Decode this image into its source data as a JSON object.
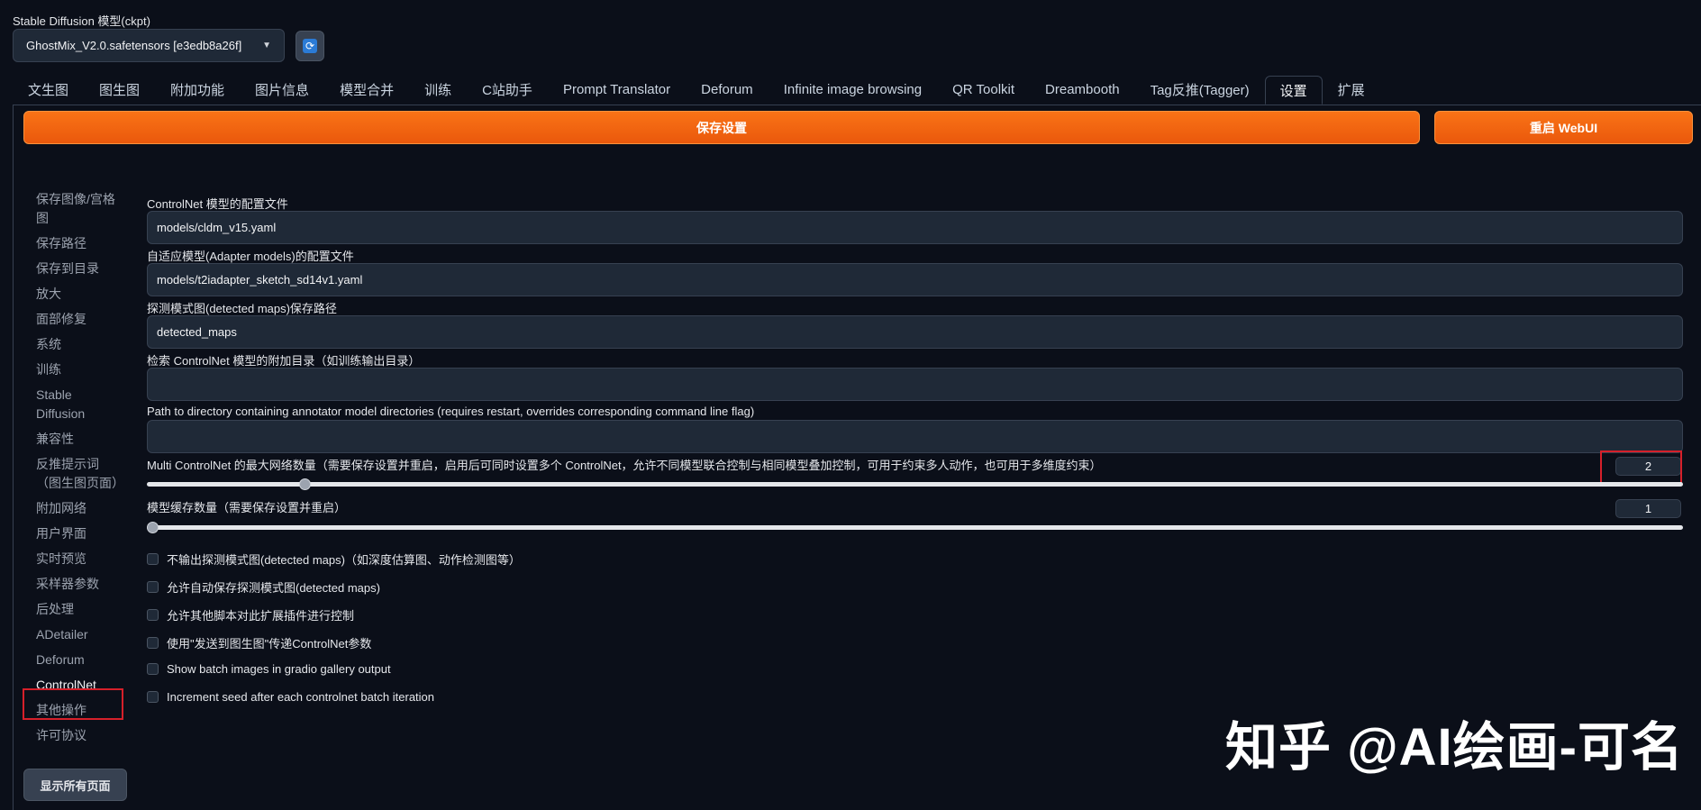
{
  "header": {
    "checkpoint_label": "Stable Diffusion 模型(ckpt)",
    "checkpoint_value": "GhostMix_V2.0.safetensors [e3edb8a26f]"
  },
  "tabs": [
    {
      "label": "文生图"
    },
    {
      "label": "图生图"
    },
    {
      "label": "附加功能"
    },
    {
      "label": "图片信息"
    },
    {
      "label": "模型合并"
    },
    {
      "label": "训练"
    },
    {
      "label": "C站助手"
    },
    {
      "label": "Prompt Translator"
    },
    {
      "label": "Deforum"
    },
    {
      "label": "Infinite image browsing"
    },
    {
      "label": "QR Toolkit"
    },
    {
      "label": "Dreambooth"
    },
    {
      "label": "Tag反推(Tagger)"
    },
    {
      "label": "设置"
    },
    {
      "label": "扩展"
    }
  ],
  "actions": {
    "save_label": "保存设置",
    "restart_label": "重启 WebUI"
  },
  "sidebar": {
    "items": [
      {
        "label": "保存图像/宫格图"
      },
      {
        "label": "保存路径"
      },
      {
        "label": "保存到目录"
      },
      {
        "label": "放大"
      },
      {
        "label": "面部修复"
      },
      {
        "label": "系统"
      },
      {
        "label": "训练"
      },
      {
        "label": "Stable Diffusion"
      },
      {
        "label": "兼容性"
      },
      {
        "label": "反推提示词（图生图页面）"
      },
      {
        "label": "附加网络"
      },
      {
        "label": "用户界面"
      },
      {
        "label": "实时预览"
      },
      {
        "label": "采样器参数"
      },
      {
        "label": "后处理"
      },
      {
        "label": "ADetailer"
      },
      {
        "label": "Deforum"
      },
      {
        "label": "ControlNet"
      },
      {
        "label": "其他操作"
      },
      {
        "label": "许可协议"
      }
    ],
    "show_all_label": "显示所有页面"
  },
  "settings": {
    "config_file_label": "ControlNet 模型的配置文件",
    "config_file_value": "models/cldm_v15.yaml",
    "adapter_config_label": "自适应模型(Adapter models)的配置文件",
    "adapter_config_value": "models/t2iadapter_sketch_sd14v1.yaml",
    "detected_maps_label": "探测模式图(detected maps)保存路径",
    "detected_maps_value": "detected_maps",
    "extra_dir_label": "检索 ControlNet 模型的附加目录（如训练输出目录）",
    "extra_dir_value": "",
    "annotator_dir_label": "Path to directory containing annotator model directories (requires restart, overrides corresponding command line flag)",
    "annotator_dir_value": "",
    "max_models_label": "Multi ControlNet 的最大网络数量（需要保存设置并重启，启用后可同时设置多个 ControlNet，允许不同模型联合控制与相同模型叠加控制，可用于约束多人动作，也可用于多维度约束）",
    "max_models_value": "2",
    "max_models_fraction": 0.1,
    "cache_label": "模型缓存数量（需要保存设置并重启）",
    "cache_value": "1",
    "cache_fraction": 0.0
  },
  "checkboxes": [
    {
      "label": "不输出探测模式图(detected maps)（如深度估算图、动作检测图等）"
    },
    {
      "label": "允许自动保存探测模式图(detected maps)"
    },
    {
      "label": "允许其他脚本对此扩展插件进行控制"
    },
    {
      "label": "使用\"发送到图生图\"传递ControlNet参数"
    },
    {
      "label": "Show batch images in gradio gallery output"
    },
    {
      "label": "Increment seed after each controlnet batch iteration"
    }
  ],
  "watermark": "知乎 @AI绘画-可名"
}
